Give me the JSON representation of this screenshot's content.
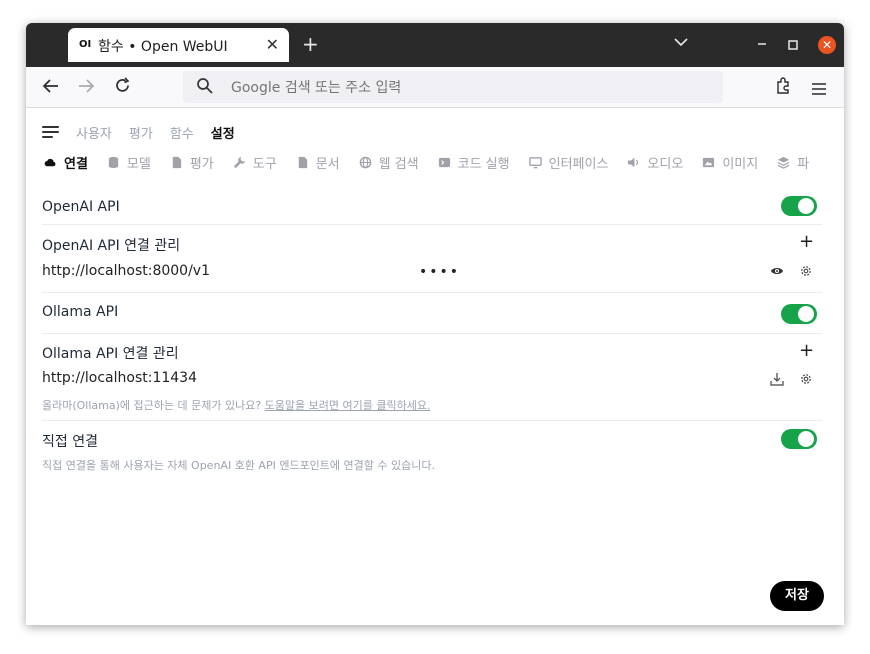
{
  "browser": {
    "tab_title": "함수 • Open WebUI",
    "tab_favicon": "OI",
    "new_tab": "+",
    "url_placeholder": "Google 검색 또는 주소 입력"
  },
  "topnav": [
    "사용자",
    "평가",
    "함수",
    "설정"
  ],
  "subnav": [
    {
      "label": "연결",
      "icon": "cloud-icon"
    },
    {
      "label": "모델",
      "icon": "database-icon"
    },
    {
      "label": "평가",
      "icon": "document-icon"
    },
    {
      "label": "도구",
      "icon": "wrench-icon"
    },
    {
      "label": "문서",
      "icon": "file-icon"
    },
    {
      "label": "웹 검색",
      "icon": "globe-icon"
    },
    {
      "label": "코드 실행",
      "icon": "terminal-icon"
    },
    {
      "label": "인터페이스",
      "icon": "monitor-icon"
    },
    {
      "label": "오디오",
      "icon": "speaker-icon"
    },
    {
      "label": "이미지",
      "icon": "image-icon"
    },
    {
      "label": "파",
      "icon": "layers-icon"
    }
  ],
  "openai": {
    "title": "OpenAI API",
    "manage_title": "OpenAI API 연결 관리",
    "url": "http://localhost:8000/v1",
    "key_mask": "••••"
  },
  "ollama": {
    "title": "Ollama API",
    "manage_title": "Ollama API 연결 관리",
    "url": "http://localhost:11434",
    "help_prefix": "올라마(Ollama)에 접근하는 데 문제가 있나요? ",
    "help_link": "도움말을 보려면 여기를 클릭하세요."
  },
  "direct": {
    "title": "직접 연결",
    "description": "직접 연결을 통해 사용자는 자체 OpenAI 호환 API 엔드포인트에 연결할 수 있습니다."
  },
  "save_label": "저장",
  "colors": {
    "toggle_on": "#16a34a",
    "accent": "#e95420"
  }
}
